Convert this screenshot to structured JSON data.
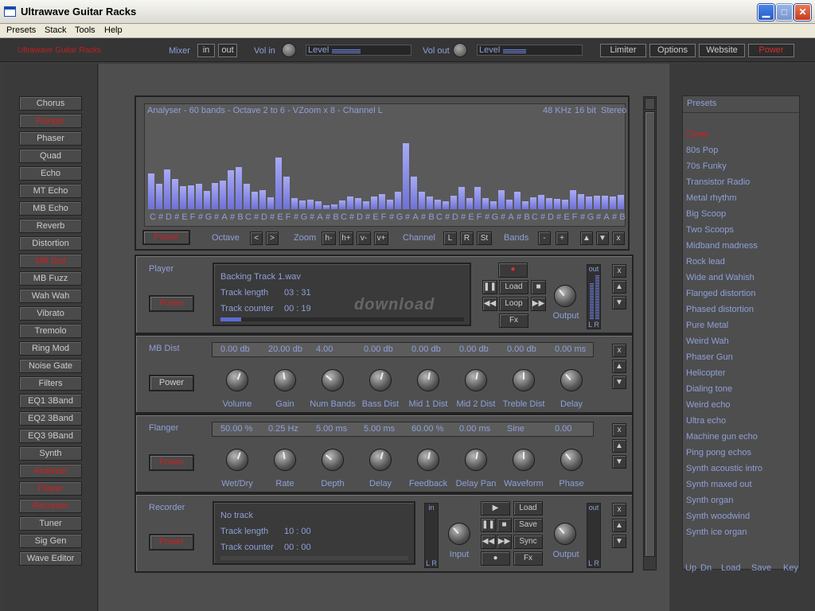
{
  "window": {
    "title": "Ultrawave Guitar Racks",
    "min": "▁",
    "max": "□",
    "close": "✕"
  },
  "menu": [
    "Presets",
    "Stack",
    "Tools",
    "Help"
  ],
  "toolbar": {
    "brand": "Ultrawave Guitar Racks",
    "mixer": "Mixer",
    "mixer_in": "in",
    "mixer_out": "out",
    "vol_in": "Vol in",
    "level": "Level",
    "vol_out": "Vol out",
    "limiter": "Limiter",
    "options": "Options",
    "website": "Website",
    "power": "Power",
    "vol_in_level": 0.7,
    "vol_out_level": 0.55
  },
  "sidebar": [
    {
      "label": "Chorus",
      "active": false
    },
    {
      "label": "Flanger",
      "active": true
    },
    {
      "label": "Phaser",
      "active": false
    },
    {
      "label": "Quad",
      "active": false
    },
    {
      "label": "Echo",
      "active": false
    },
    {
      "label": "MT Echo",
      "active": false
    },
    {
      "label": "MB Echo",
      "active": false
    },
    {
      "label": "Reverb",
      "active": false
    },
    {
      "label": "Distortion",
      "active": false
    },
    {
      "label": "MB Dist",
      "active": true
    },
    {
      "label": "MB Fuzz",
      "active": false
    },
    {
      "label": "Wah Wah",
      "active": false
    },
    {
      "label": "Vibrato",
      "active": false
    },
    {
      "label": "Tremolo",
      "active": false
    },
    {
      "label": "Ring Mod",
      "active": false
    },
    {
      "label": "Noise Gate",
      "active": false
    },
    {
      "label": "Filters",
      "active": false
    },
    {
      "label": "EQ1 3Band",
      "active": false
    },
    {
      "label": "EQ2 3Band",
      "active": false
    },
    {
      "label": "EQ3 9Band",
      "active": false
    },
    {
      "label": "Synth",
      "active": false
    },
    {
      "label": "Analyzer",
      "active": true
    },
    {
      "label": "Player",
      "active": true
    },
    {
      "label": "Recorder",
      "active": true
    },
    {
      "label": "Tuner",
      "active": false
    },
    {
      "label": "Sig Gen",
      "active": false
    },
    {
      "label": "Wave Editor",
      "active": false
    }
  ],
  "analyser": {
    "title": "Analyser - 60 bands - Octave 2 to 6 - VZoom x 8 - Channel L",
    "rate": "48 KHz",
    "bits": "16 bit",
    "mode": "Stereo",
    "power": "Power",
    "octave": "Octave",
    "oct_down": "<",
    "oct_up": ">",
    "zoom": "Zoom",
    "zoom_hm": "h-",
    "zoom_hp": "h+",
    "zoom_vm": "v-",
    "zoom_vp": "v+",
    "channel": "Channel",
    "ch_l": "L",
    "ch_r": "R",
    "ch_st": "St",
    "bands": "Bands",
    "bands_m": "-",
    "bands_p": "+",
    "up": "▲",
    "down": "▼",
    "close": "x",
    "notes": [
      "C",
      "#",
      "D",
      "#",
      "E",
      "F",
      "#",
      "G",
      "#",
      "A",
      "#",
      "B",
      "C",
      "#",
      "D",
      "#",
      "E",
      "F",
      "#",
      "G",
      "#",
      "A",
      "#",
      "B",
      "C",
      "#",
      "D",
      "#",
      "E",
      "F",
      "#",
      "G",
      "#",
      "A",
      "#",
      "B",
      "C",
      "#",
      "D",
      "#",
      "E",
      "F",
      "#",
      "G",
      "#",
      "A",
      "#",
      "B",
      "C",
      "#",
      "D",
      "#",
      "E",
      "F",
      "#",
      "G",
      "#",
      "A",
      "#",
      "B"
    ]
  },
  "chart_data": {
    "type": "bar",
    "title": "Analyser - 60 bands - Octave 2 to 6 - VZoom x 8 - Channel L",
    "categories": [
      "C",
      "#",
      "D",
      "#",
      "E",
      "F",
      "#",
      "G",
      "#",
      "A",
      "#",
      "B",
      "C",
      "#",
      "D",
      "#",
      "E",
      "F",
      "#",
      "G",
      "#",
      "A",
      "#",
      "B",
      "C",
      "#",
      "D",
      "#",
      "E",
      "F",
      "#",
      "G",
      "#",
      "A",
      "#",
      "B",
      "C",
      "#",
      "D",
      "#",
      "E",
      "F",
      "#",
      "G",
      "#",
      "A",
      "#",
      "B",
      "C",
      "#",
      "D",
      "#",
      "E",
      "F",
      "#",
      "G",
      "#",
      "A",
      "#",
      "B"
    ],
    "values": [
      0.42,
      0.3,
      0.46,
      0.35,
      0.27,
      0.28,
      0.3,
      0.21,
      0.31,
      0.33,
      0.45,
      0.49,
      0.3,
      0.2,
      0.22,
      0.14,
      0.6,
      0.38,
      0.13,
      0.1,
      0.11,
      0.09,
      0.05,
      0.06,
      0.1,
      0.15,
      0.13,
      0.09,
      0.15,
      0.18,
      0.11,
      0.2,
      0.77,
      0.38,
      0.2,
      0.15,
      0.11,
      0.09,
      0.16,
      0.26,
      0.13,
      0.26,
      0.13,
      0.09,
      0.22,
      0.11,
      0.2,
      0.09,
      0.14,
      0.17,
      0.13,
      0.12,
      0.11,
      0.22,
      0.18,
      0.15,
      0.16,
      0.16,
      0.15,
      0.17
    ]
  },
  "player": {
    "label": "Player",
    "power": "Power",
    "track": "Backing Track 1.wav",
    "len_lbl": "Track length",
    "len_val": "03 : 31",
    "cnt_lbl": "Track counter",
    "cnt_val": "00 : 19",
    "load": "Load",
    "loop": "Loop",
    "fx": "Fx",
    "output": "Output",
    "out": "out",
    "lr": "L R",
    "close": "x",
    "up": "▲",
    "down": "▼",
    "watermark": "download"
  },
  "mbdist": {
    "label": "MB Dist",
    "power": "Power",
    "values": [
      "0.00 db",
      "20.00 db",
      "4.00",
      "0.00 db",
      "0.00 db",
      "0.00 db",
      "0.00 db",
      "0.00 ms"
    ],
    "knobs": [
      "Volume",
      "Gain",
      "Num Bands",
      "Bass Dist",
      "Mid 1 Dist",
      "Mid 2 Dist",
      "Treble Dist",
      "Delay"
    ],
    "close": "x",
    "up": "▲",
    "down": "▼"
  },
  "flanger": {
    "label": "Flanger",
    "power": "Power",
    "values": [
      "50.00 %",
      "0.25 Hz",
      "5.00 ms",
      "5.00 ms",
      "60.00 %",
      "0.00 ms",
      "Sine",
      "0.00"
    ],
    "knobs": [
      "Wet/Dry",
      "Rate",
      "Depth",
      "Delay",
      "Feedback",
      "Delay Pan",
      "Waveform",
      "Phase"
    ],
    "close": "x",
    "up": "▲",
    "down": "▼"
  },
  "recorder": {
    "label": "Recorder",
    "power": "Power",
    "track": "No track",
    "len_lbl": "Track length",
    "len_val": "10 : 00",
    "cnt_lbl": "Track counter",
    "cnt_val": "00 : 00",
    "in": "in",
    "input": "Input",
    "load": "Load",
    "save": "Save",
    "sync": "Sync",
    "fx": "Fx",
    "output": "Output",
    "out": "out",
    "lr": "L R",
    "close": "x",
    "up": "▲",
    "down": "▼"
  },
  "presets": {
    "heading": "Presets",
    "items": [
      {
        "label": "Clean",
        "active": true
      },
      {
        "label": "80s Pop",
        "active": false
      },
      {
        "label": "70s Funky",
        "active": false
      },
      {
        "label": "Transistor Radio",
        "active": false
      },
      {
        "label": "Metal rhythm",
        "active": false
      },
      {
        "label": "Big Scoop",
        "active": false
      },
      {
        "label": "Two Scoops",
        "active": false
      },
      {
        "label": "Midband madness",
        "active": false
      },
      {
        "label": "Rock lead",
        "active": false
      },
      {
        "label": "Wide and Wahish",
        "active": false
      },
      {
        "label": "Flanged distortion",
        "active": false
      },
      {
        "label": "Phased distortion",
        "active": false
      },
      {
        "label": "Pure Metal",
        "active": false
      },
      {
        "label": "Weird Wah",
        "active": false
      },
      {
        "label": "Phaser Gun",
        "active": false
      },
      {
        "label": "Helicopter",
        "active": false
      },
      {
        "label": "Dialing tone",
        "active": false
      },
      {
        "label": "Weird echo",
        "active": false
      },
      {
        "label": "Ultra echo",
        "active": false
      },
      {
        "label": "Machine gun echo",
        "active": false
      },
      {
        "label": "Ping pong echos",
        "active": false
      },
      {
        "label": "Synth acoustic intro",
        "active": false
      },
      {
        "label": "Synth maxed out",
        "active": false
      },
      {
        "label": "Synth organ",
        "active": false
      },
      {
        "label": "Synth woodwind",
        "active": false
      },
      {
        "label": "Synth ice organ",
        "active": false
      }
    ],
    "footer": [
      "Up",
      "Dn",
      "Load",
      "Save",
      "Key"
    ]
  }
}
